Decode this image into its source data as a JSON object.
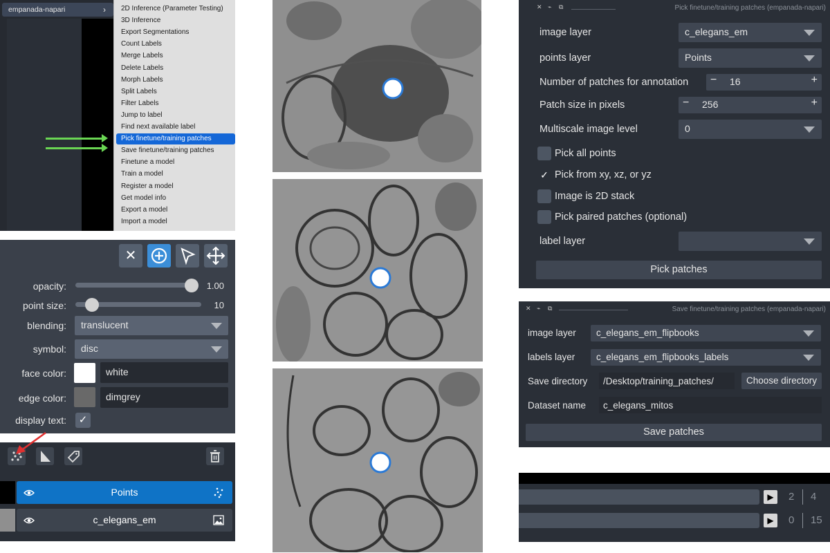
{
  "menu": {
    "plugin_name": "empanada-napari",
    "items": [
      "2D Inference (Parameter Testing)",
      "3D Inference",
      "Export Segmentations",
      "Count Labels",
      "Merge Labels",
      "Delete Labels",
      "Morph Labels",
      "Split Labels",
      "Filter Labels",
      "Jump to label",
      "Find next available label",
      "Pick finetune/training patches",
      "Save finetune/training patches",
      "Finetune a model",
      "Train a model",
      "Register a model",
      "Get model info",
      "Export a model",
      "Import a model"
    ],
    "selected_index": 11,
    "arrow_color": "#6ad653",
    "selection_color": "#1467d7"
  },
  "layer_controls": {
    "tools": {
      "delete_icon": "close-icon",
      "add_icon": "add-points-icon",
      "select_icon": "select-arrow-icon",
      "pan_icon": "pan-zoom-icon"
    },
    "opacity": {
      "label": "opacity:",
      "value": "1.00",
      "fraction": 1.0
    },
    "point_size": {
      "label": "point size:",
      "value": "10",
      "fraction": 0.13
    },
    "blending": {
      "label": "blending:",
      "value": "translucent"
    },
    "symbol": {
      "label": "symbol:",
      "value": "disc"
    },
    "face_color": {
      "label": "face color:",
      "value": "white",
      "swatch": "#ffffff"
    },
    "edge_color": {
      "label": "edge color:",
      "value": "dimgrey",
      "swatch": "#696969"
    },
    "display_text": {
      "label": "display text:",
      "checked": true
    }
  },
  "layer_list": {
    "buttons": [
      "new-points-layer-icon",
      "new-shapes-layer-icon",
      "new-labels-layer-icon",
      "delete-layer-icon"
    ],
    "annotation_arrow_color": "#e23030",
    "layers": [
      {
        "name": "Points",
        "selected": true,
        "icon": "points-layer-icon"
      },
      {
        "name": "c_elegans_em",
        "selected": false,
        "icon": "image-layer-icon"
      }
    ]
  },
  "pick_panel": {
    "title": "Pick finetune/training patches (empanada-napari)",
    "image_layer": {
      "label": "image layer",
      "value": "c_elegans_em"
    },
    "points_layer": {
      "label": "points layer",
      "value": "Points"
    },
    "num_patches": {
      "label": "Number of patches for annotation",
      "value": "16"
    },
    "patch_size": {
      "label": "Patch size in pixels",
      "value": "256"
    },
    "multiscale": {
      "label": "Multiscale image level",
      "value": "0"
    },
    "checks": [
      {
        "label": "Pick all points",
        "checked": false
      },
      {
        "label": "Pick from xy, xz, or yz",
        "checked": true
      },
      {
        "label": "Image is 2D stack",
        "checked": false
      },
      {
        "label": "Pick paired patches (optional)",
        "checked": false
      }
    ],
    "label_layer": {
      "label": "label layer",
      "value": ""
    },
    "button": "Pick patches"
  },
  "save_panel": {
    "title": "Save finetune/training patches (empanada-napari)",
    "image_layer": {
      "label": "image layer",
      "value": "c_elegans_em_flipbooks"
    },
    "labels_layer": {
      "label": "labels layer",
      "value": "c_elegans_em_flipbooks_labels"
    },
    "save_directory": {
      "label": "Save directory",
      "value": "/Desktop/training_patches/",
      "button": "Choose directory"
    },
    "dataset_name": {
      "label": "Dataset name",
      "value": "c_elegans_mitos"
    },
    "button": "Save patches"
  },
  "dims": {
    "sliders": [
      {
        "current": "2",
        "total": "4"
      },
      {
        "current": "0",
        "total": "15"
      }
    ]
  }
}
